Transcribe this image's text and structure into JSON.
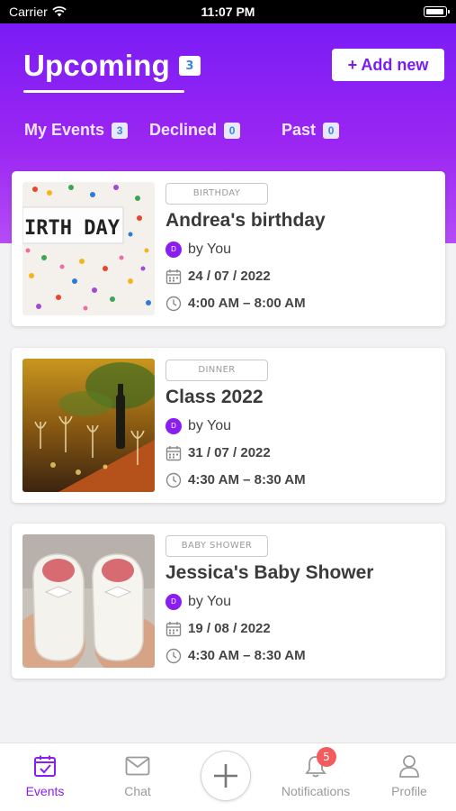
{
  "status_bar": {
    "carrier": "Carrier",
    "time": "11:07 PM"
  },
  "header": {
    "title": "Upcoming",
    "title_count": "3",
    "add_button": "+ Add new",
    "tabs": [
      {
        "label": "My Events",
        "count": "3"
      },
      {
        "label": "Declined",
        "count": "0"
      },
      {
        "label": "Past",
        "count": "0"
      }
    ]
  },
  "events": [
    {
      "category": "BIRTHDAY",
      "title": "Andrea's birthday",
      "avatar_initial": "D",
      "organizer": "by You",
      "date": "24 / 07 / 2022",
      "time": "4:00 AM – 8:00 AM",
      "thumb_text": "IRTH DAY"
    },
    {
      "category": "DINNER",
      "title": "Class 2022",
      "avatar_initial": "D",
      "organizer": "by You",
      "date": "31 / 07 / 2022",
      "time": "4:30 AM – 8:30 AM"
    },
    {
      "category": "BABY SHOWER",
      "title": "Jessica's Baby Shower",
      "avatar_initial": "D",
      "organizer": "by You",
      "date": "19 / 08 / 2022",
      "time": "4:30 AM – 8:30 AM"
    }
  ],
  "bottom_nav": {
    "items": [
      {
        "label": "Events",
        "icon": "calendar-check-icon"
      },
      {
        "label": "Chat",
        "icon": "envelope-icon"
      },
      {
        "label": "Notifications",
        "icon": "bell-icon",
        "badge": "5"
      },
      {
        "label": "Profile",
        "icon": "person-icon"
      }
    ],
    "center_icon": "plus-icon"
  },
  "colors": {
    "accent": "#8a1df0",
    "header_top": "#7a1cf5",
    "header_bottom": "#b54cf6",
    "count_text": "#3a86d8",
    "badge": "#f25c5c"
  }
}
